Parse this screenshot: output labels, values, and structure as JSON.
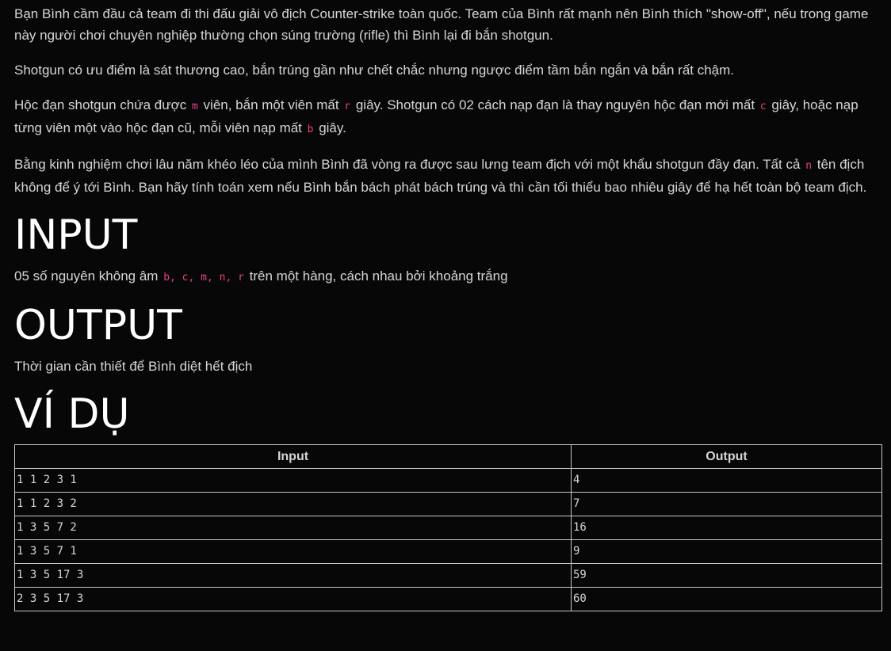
{
  "paragraphs": {
    "p1": "Bạn Bình cầm đầu cả team đi thi đấu giải vô địch Counter-strike toàn quốc. Team của Bình rất mạnh nên Bình thích \"show-off\", nếu trong game này người chơi chuyên nghiệp thường chọn súng trường (rifle) thì Bình lại đi bắn shotgun.",
    "p2": "Shotgun có ưu điểm là sát thương cao, bắn trúng gần như chết chắc nhưng ngược điểm tầm bắn ngắn và bắn rất chậm.",
    "p3": {
      "t1": "Hộc đạn shotgun chứa được ",
      "c1": "m",
      "t2": " viên, bắn một viên mất ",
      "c2": "r",
      "t3": " giây. Shotgun có 02 cách nạp đạn là thay nguyên hộc đạn mới mất ",
      "c3": "c",
      "t4": " giây, hoặc nạp từng viên một vào hộc đạn cũ, mỗi viên nạp mất ",
      "c4": "b",
      "t5": " giây."
    },
    "p4": {
      "t1": "Bằng kinh nghiệm chơi lâu năm khéo léo của mình Bình đã vòng ra được sau lưng team địch với một khẩu shotgun đầy đạn. Tất cả ",
      "c1": "n",
      "t2": " tên địch không để ý tới Bình. Bạn hãy tính toán xem nếu Bình bắn bách phát bách trúng và thì cần tối thiểu bao nhiêu giây để hạ hết toàn bộ team địch."
    }
  },
  "input_section": {
    "heading": "INPUT",
    "text_before": "05 số nguyên không âm ",
    "code": "b, c, m, n, r",
    "text_after": " trên một hàng, cách nhau bởi khoảng trắng"
  },
  "output_section": {
    "heading": "OUTPUT",
    "text": "Thời gian cần thiết để Bình diệt hết địch"
  },
  "example_section": {
    "heading": "VÍ DỤ",
    "headers": {
      "input": "Input",
      "output": "Output"
    },
    "rows": [
      {
        "input": "1 1 2 3 1",
        "output": "4"
      },
      {
        "input": "1 1 2 3 2",
        "output": "7"
      },
      {
        "input": "1 3 5 7 2",
        "output": "16"
      },
      {
        "input": "1 3 5 7 1",
        "output": "9"
      },
      {
        "input": "1 3 5 17 3",
        "output": "59"
      },
      {
        "input": "2 3 5 17 3",
        "output": "60"
      }
    ]
  },
  "colors": {
    "background": "#070707",
    "text": "#d6d6d6",
    "heading": "#ffffff",
    "code": "#e83e8c",
    "border": "#c8c8c8"
  }
}
